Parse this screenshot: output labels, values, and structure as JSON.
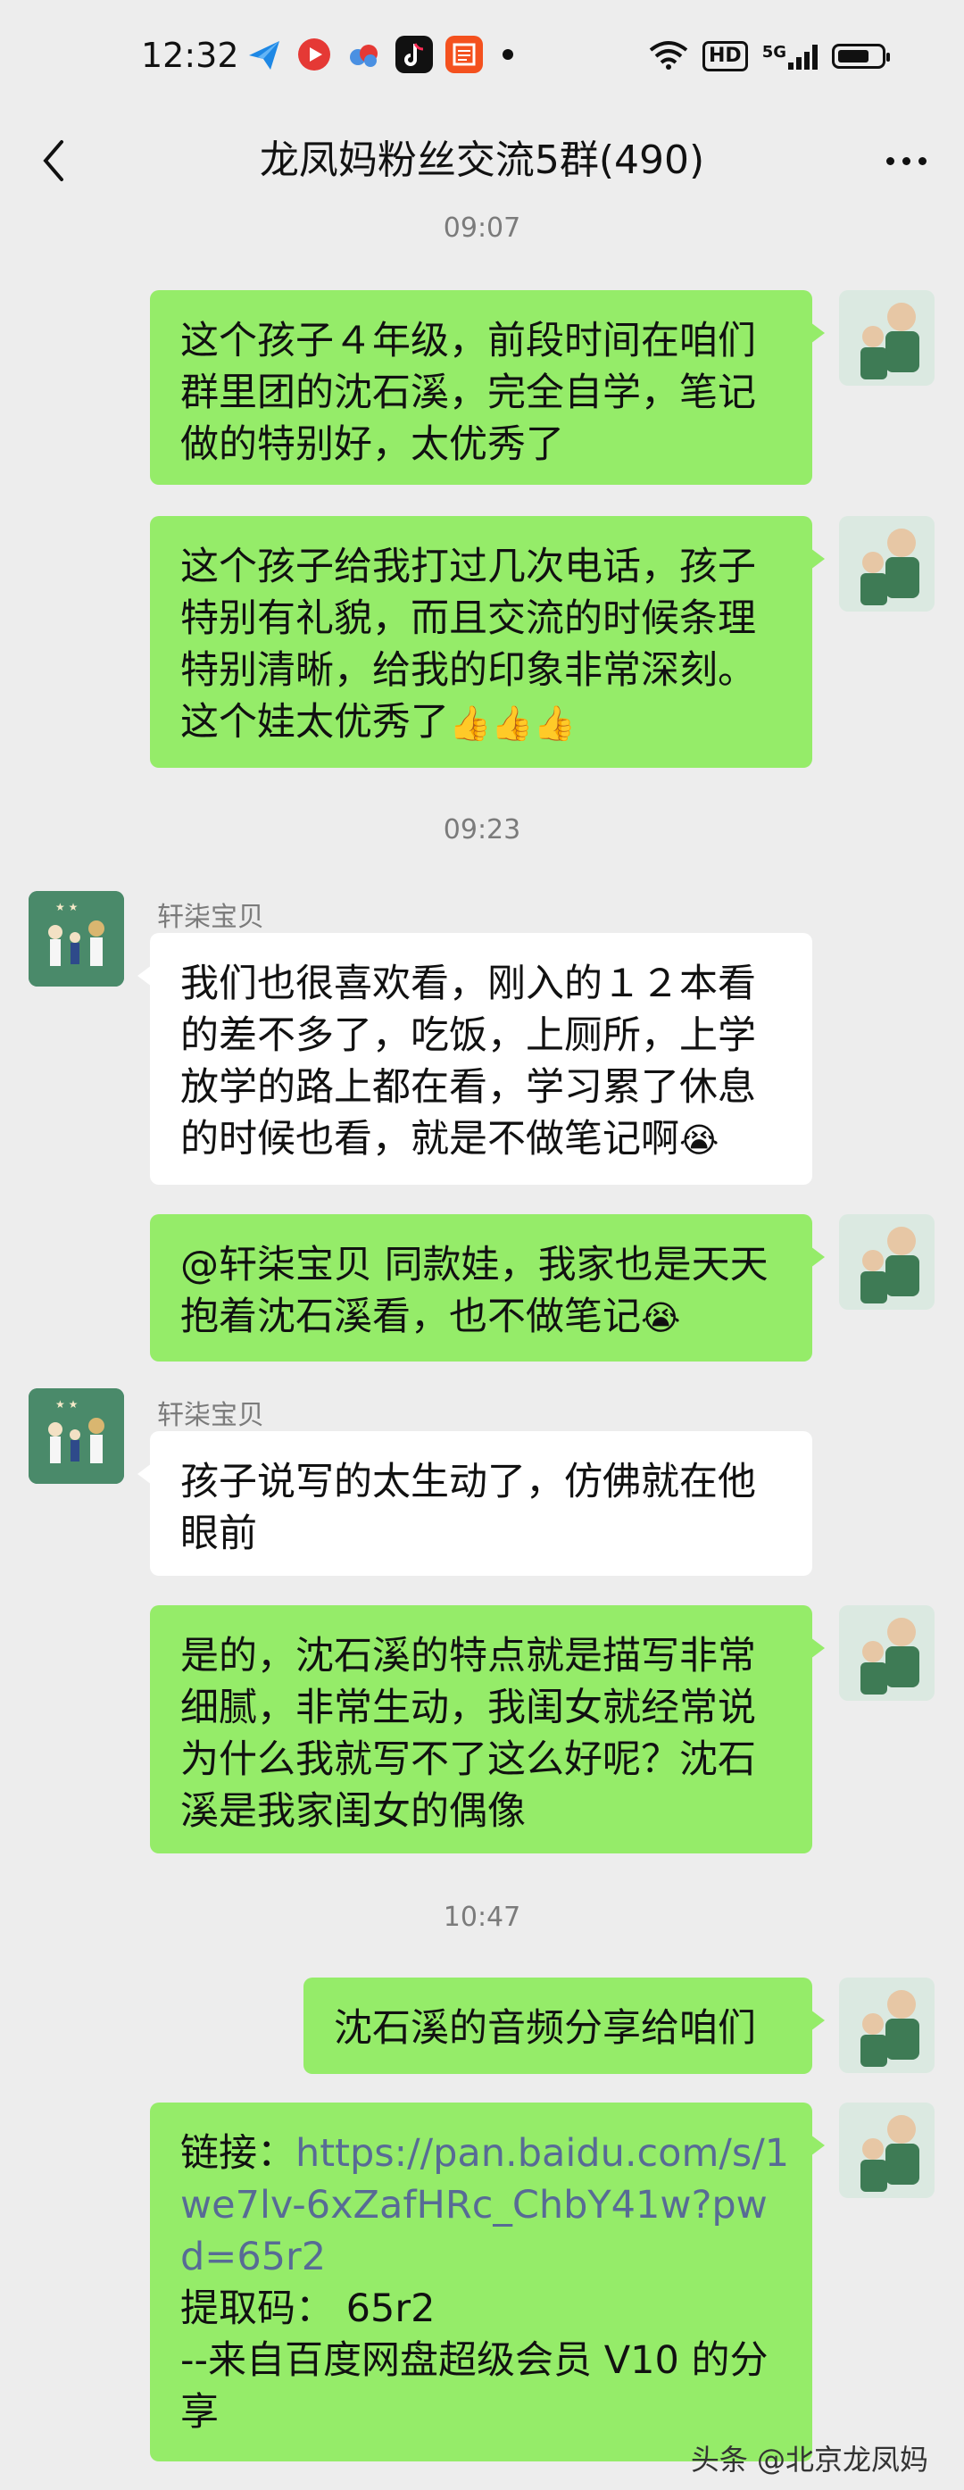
{
  "status_bar": {
    "time": "12:32",
    "hd": "HD",
    "network": "5G"
  },
  "nav": {
    "title": "龙凤妈粉丝交流5群(490)"
  },
  "timestamps": [
    "09:07",
    "09:23",
    "10:47"
  ],
  "messages": [
    {
      "sender": "me",
      "text": "这个孩子４年级，前段时间在咱们群里团的沈石溪，完全自学，笔记做的特别好，太优秀了"
    },
    {
      "sender": "me",
      "text": "这个孩子给我打过几次电话，孩子特别有礼貌，而且交流的时候条理特别清晰，给我的印象非常深刻。这个娃太优秀了",
      "emoji": "👍👍👍"
    },
    {
      "sender": "轩柒宝贝",
      "text": "我们也很喜欢看，刚入的１２本看的差不多了，吃饭，上厕所，上学放学的路上都在看，学习累了休息的时候也看，就是不做笔记啊",
      "emoji": "😭"
    },
    {
      "sender": "me",
      "text": "@轩柒宝贝  同款娃，我家也是天天抱着沈石溪看，也不做笔记",
      "emoji": "😭"
    },
    {
      "sender": "轩柒宝贝",
      "text": "孩子说写的太生动了，仿佛就在他眼前"
    },
    {
      "sender": "me",
      "text": "是的，沈石溪的特点就是描写非常细腻，非常生动，我闺女就经常说为什么我就写不了这么好呢？沈石溪是我家闺女的偶像"
    },
    {
      "sender": "me",
      "text": "沈石溪的音频分享给咱们"
    },
    {
      "sender": "me",
      "link_label": "链接：",
      "link_url": "https://pan.baidu.com/s/1we7lv-6xZafHRc_ChbY41w?pwd=65r2",
      "code_line": "提取码：  65r2",
      "footer_line": "--来自百度网盘超级会员 V10 的分享"
    }
  ],
  "watermark": "头条 @北京龙凤妈",
  "colors": {
    "my_bubble": "#95ec69",
    "other_bubble": "#ffffff",
    "background": "#ededed",
    "link": "#576b95"
  }
}
